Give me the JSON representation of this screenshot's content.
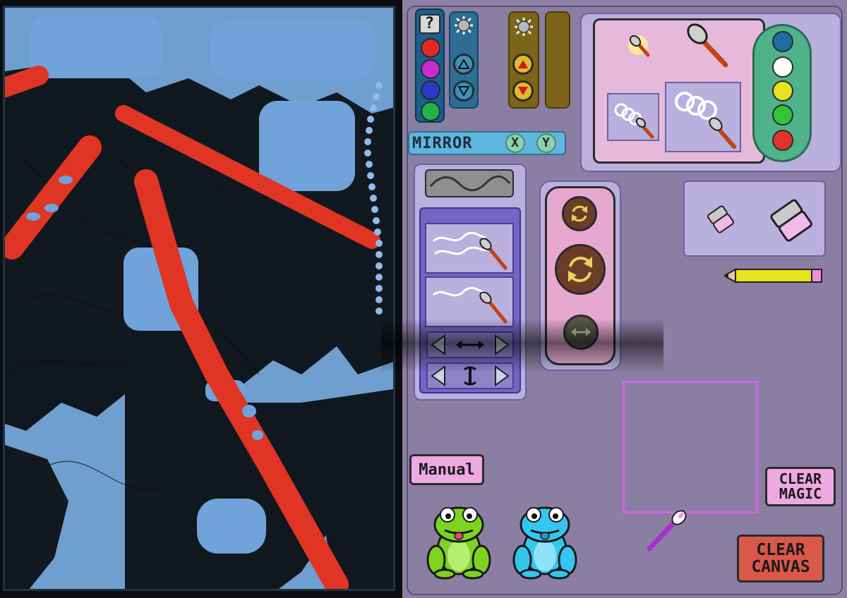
{
  "help": {
    "label": "?"
  },
  "mirror": {
    "label": "MIRROR",
    "x_label": "X",
    "y_label": "Y"
  },
  "manual": {
    "label": "Manual"
  },
  "clear_magic": {
    "line1": "CLEAR",
    "line2": "MAGIC"
  },
  "clear_canvas": {
    "line1": "CLEAR",
    "line2": "CANVAS"
  },
  "colors": {
    "canvas_bg": "#6e9fcf",
    "panel_bg": "#8a7ea3",
    "stroke_red": "#e03524",
    "palette_left": [
      "#e02a2a",
      "#c62ad2",
      "#2b38c8",
      "#22b24a"
    ],
    "palette_right": [
      "#1c6fa0",
      "#ffffff",
      "#e7e21f",
      "#33c43a",
      "#e0342a"
    ]
  },
  "icons": {
    "brightness_left": "brightness-icon",
    "brightness_right": "brightness-icon",
    "size_up": "arrow-up-icon",
    "size_down": "arrow-down-icon",
    "rotate_small": "rotate-icon",
    "rotate_large": "rotate-icon",
    "flip": "flip-icon",
    "eraser": "eraser-icon",
    "pencil": "pencil-icon",
    "brush": "brush-icon",
    "frog_green": "frog-icon",
    "frog_blue": "frog-icon"
  }
}
